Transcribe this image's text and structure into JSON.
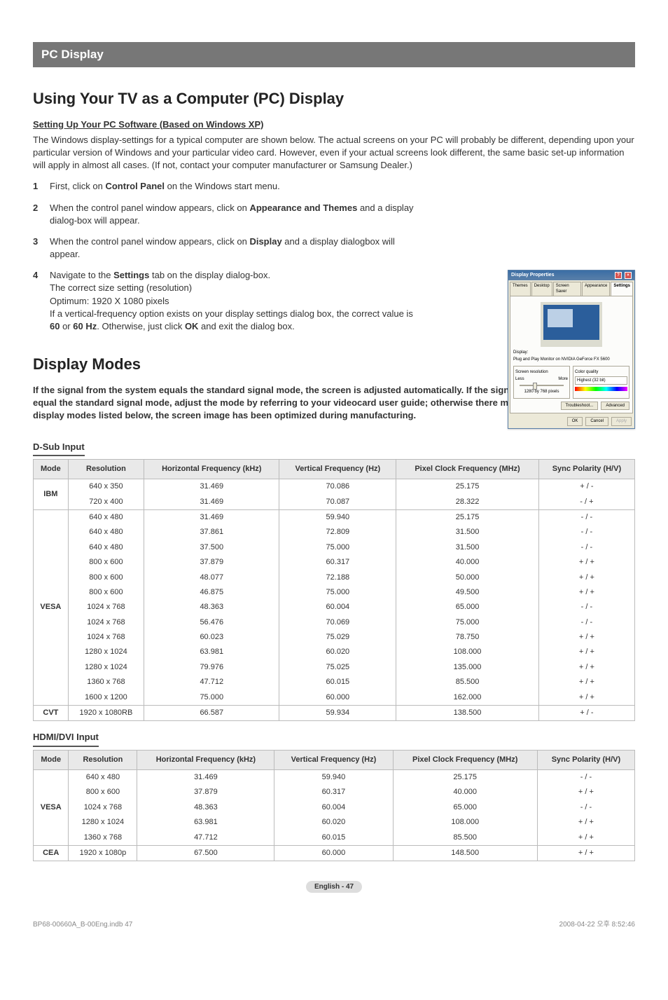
{
  "section_title": "PC Display",
  "h1a": "Using Your TV as a Computer (PC) Display",
  "sub_a": "Setting Up Your PC Software (Based on Windows XP)",
  "intro": "The Windows display-settings for a typical computer are shown below. The actual screens on your PC will probably be different, depending upon your particular version of Windows and your particular video card. However, even if your actual screens look different, the same basic set-up information will apply in almost all cases. (If not, contact your computer manufacturer or Samsung Dealer.)",
  "steps": [
    {
      "n": "1",
      "html": "First, click on <b>Control Panel</b> on the Windows start menu."
    },
    {
      "n": "2",
      "html": "When the control panel window appears, click on <b>Appearance and Themes</b> and a display dialog-box will appear."
    },
    {
      "n": "3",
      "html": "When the control panel window appears, click on <b>Display</b> and a display dialogbox will appear."
    },
    {
      "n": "4",
      "html": "Navigate to the <b>Settings</b> tab on the display dialog-box.<br>The correct size setting (resolution)<br>Optimum: 1920 X 1080 pixels<br>If a vertical-frequency option exists on your display settings dialog box, the correct value is <b>60</b> or <b>60 Hz</b>. Otherwise, just click <b>OK</b> and exit the dialog box."
    }
  ],
  "h1b": "Display Modes",
  "modes_intro": "If the signal from the system equals the standard signal mode, the screen is adjusted automatically. If the signal from the system doesn't equal the standard signal mode, adjust the mode by referring to your videocard user guide; otherwise there may be no video. For the display modes listed below, the screen image has been optimized during manufacturing.",
  "table_headers": [
    "Mode",
    "Resolution",
    "Horizontal Frequency (kHz)",
    "Vertical Frequency (Hz)",
    "Pixel Clock Frequency (MHz)",
    "Sync Polarity (H/V)"
  ],
  "dsub_label": "D-Sub Input",
  "dsub_groups": [
    {
      "mode": "IBM",
      "rows": [
        [
          "640 x 350",
          "31.469",
          "70.086",
          "25.175",
          "+ / -"
        ],
        [
          "720 x 400",
          "31.469",
          "70.087",
          "28.322",
          "- / +"
        ]
      ]
    },
    {
      "mode": "VESA",
      "rows": [
        [
          "640 x 480",
          "31.469",
          "59.940",
          "25.175",
          "- / -"
        ],
        [
          "640 x 480",
          "37.861",
          "72.809",
          "31.500",
          "- / -"
        ],
        [
          "640 x 480",
          "37.500",
          "75.000",
          "31.500",
          "- / -"
        ],
        [
          "800 x 600",
          "37.879",
          "60.317",
          "40.000",
          "+ / +"
        ],
        [
          "800 x 600",
          "48.077",
          "72.188",
          "50.000",
          "+ / +"
        ],
        [
          "800 x 600",
          "46.875",
          "75.000",
          "49.500",
          "+ / +"
        ],
        [
          "1024 x 768",
          "48.363",
          "60.004",
          "65.000",
          "- / -"
        ],
        [
          "1024 x 768",
          "56.476",
          "70.069",
          "75.000",
          "- / -"
        ],
        [
          "1024 x 768",
          "60.023",
          "75.029",
          "78.750",
          "+ / +"
        ],
        [
          "1280 x 1024",
          "63.981",
          "60.020",
          "108.000",
          "+ / +"
        ],
        [
          "1280 x 1024",
          "79.976",
          "75.025",
          "135.000",
          "+ / +"
        ],
        [
          "1360 x 768",
          "47.712",
          "60.015",
          "85.500",
          "+ / +"
        ],
        [
          "1600 x 1200",
          "75.000",
          "60.000",
          "162.000",
          "+ / +"
        ]
      ]
    },
    {
      "mode": "CVT",
      "rows": [
        [
          "1920 x 1080RB",
          "66.587",
          "59.934",
          "138.500",
          "+ / -"
        ]
      ]
    }
  ],
  "hdmi_label": "HDMI/DVI Input",
  "hdmi_groups": [
    {
      "mode": "VESA",
      "rows": [
        [
          "640 x 480",
          "31.469",
          "59.940",
          "25.175",
          "- / -"
        ],
        [
          "800 x 600",
          "37.879",
          "60.317",
          "40.000",
          "+ / +"
        ],
        [
          "1024 x 768",
          "48.363",
          "60.004",
          "65.000",
          "- / -"
        ],
        [
          "1280 x 1024",
          "63.981",
          "60.020",
          "108.000",
          "+ / +"
        ],
        [
          "1360 x 768",
          "47.712",
          "60.015",
          "85.500",
          "+ / +"
        ]
      ]
    },
    {
      "mode": "CEA",
      "rows": [
        [
          "1920 x 1080p",
          "67.500",
          "60.000",
          "148.500",
          "+ / +"
        ]
      ]
    }
  ],
  "page_footer": "English - 47",
  "meta_left": "BP68-00660A_B-00Eng.indb   47",
  "meta_right": "2008-04-22   오후 8:52:46",
  "dialog": {
    "title": "Display Properties",
    "tabs": [
      "Themes",
      "Desktop",
      "Screen Saver",
      "Appearance",
      "Settings"
    ],
    "display_label": "Display:",
    "display_value": "Plug and Play Monitor on NVIDIA GeForce FX 5600",
    "res_label": "Screen resolution",
    "res_less": "Less",
    "res_more": "More",
    "res_value": "1280 by 768 pixels",
    "cq_label": "Color quality",
    "cq_value": "Highest (32 bit)",
    "btn_trouble": "Troubleshoot...",
    "btn_adv": "Advanced",
    "btn_ok": "OK",
    "btn_cancel": "Cancel",
    "btn_apply": "Apply"
  }
}
